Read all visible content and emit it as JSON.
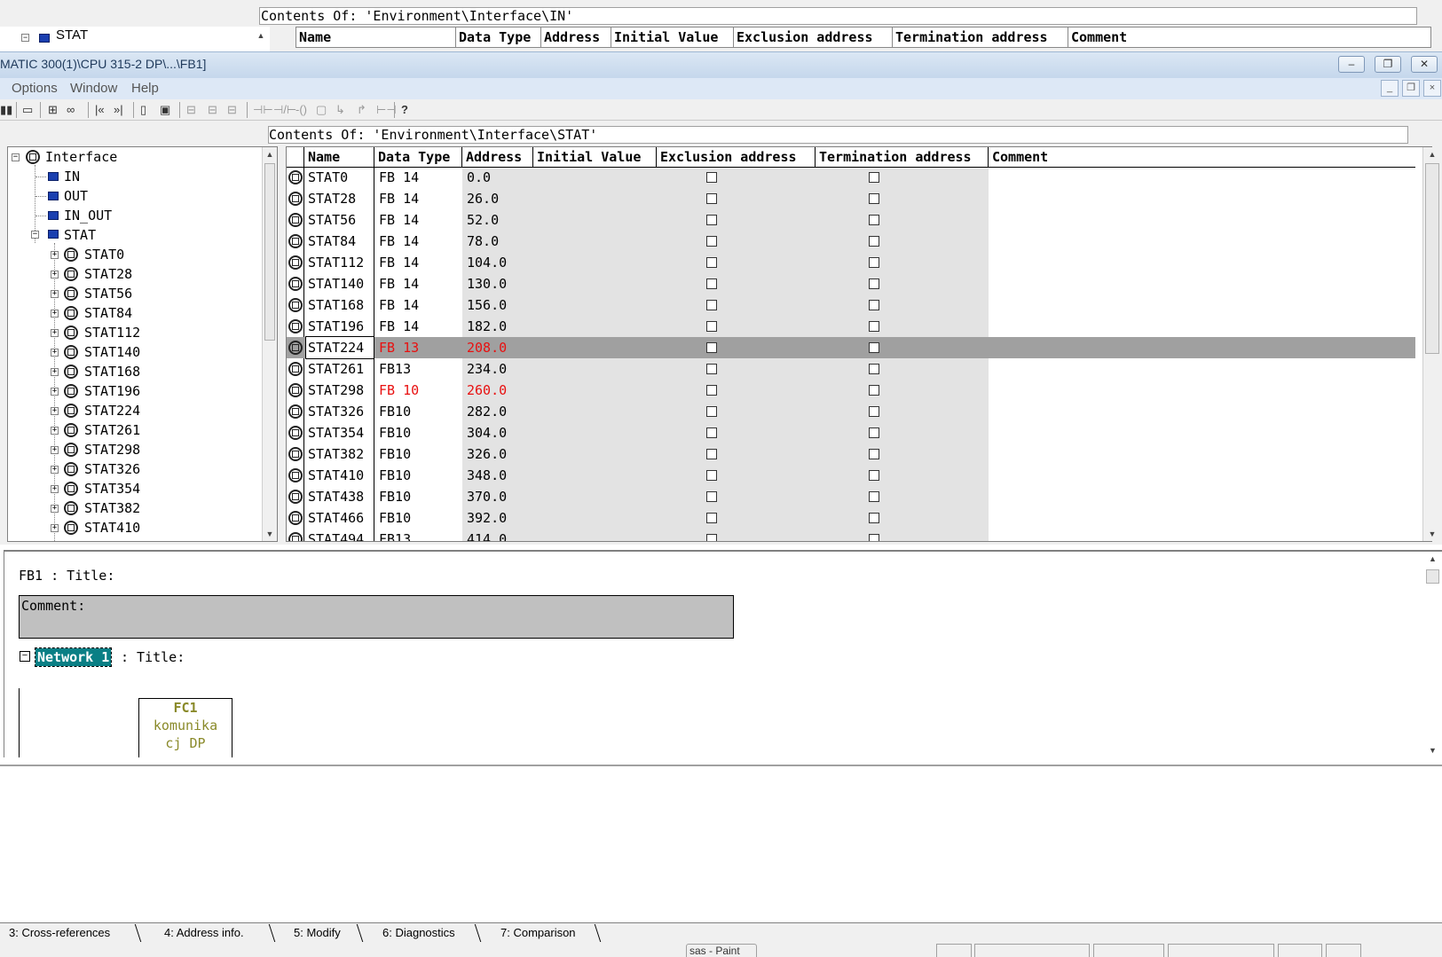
{
  "background_window": {
    "tree_item": "STAT",
    "contents_label": "Contents Of: 'Environment\\Interface\\IN'",
    "columns": [
      "Name",
      "Data Type",
      "Address",
      "Initial Value",
      "Exclusion address",
      "Termination address",
      "Comment"
    ]
  },
  "window": {
    "title": "MATIC 300(1)\\CPU 315-2 DP\\...\\FB1]",
    "controls": {
      "minimize": "–",
      "restore": "❐",
      "close": "✕"
    }
  },
  "menu": {
    "items": [
      "Options",
      "Window",
      "Help"
    ],
    "mdi_controls": [
      "_",
      "❐",
      "×"
    ]
  },
  "toolbar": {
    "icons": [
      "network-icon",
      "open-block-icon",
      "dependency-icon",
      "monitor-icon",
      "first-error-icon",
      "next-error-icon",
      "overview-icon",
      "detail-view-icon",
      "network-insert-icon",
      "branch-icon",
      "parallel-branch-icon",
      "nc-contact-icon",
      "coil-icon",
      "box-icon",
      "open-branch-icon",
      "close-branch-icon",
      "connection-icon",
      "help-icon"
    ],
    "glyphs": [
      "▮▮",
      "▭",
      "⊞",
      "∞",
      "|«",
      "»|",
      "▯",
      "▣",
      "⊟",
      "⊟",
      "⊟",
      "⊣⊢",
      "⊣/⊢",
      "-()",
      "▢",
      "↳",
      "↱",
      "⊢⊣",
      "?"
    ]
  },
  "declaration": {
    "contents_label": "Contents Of: 'Environment\\Interface\\STAT'",
    "tree": {
      "root": "Interface",
      "sections": [
        "IN",
        "OUT",
        "IN_OUT",
        "STAT"
      ],
      "stat_children": [
        "STAT0",
        "STAT28",
        "STAT56",
        "STAT84",
        "STAT112",
        "STAT140",
        "STAT168",
        "STAT196",
        "STAT224",
        "STAT261",
        "STAT298",
        "STAT326",
        "STAT354",
        "STAT382",
        "STAT410"
      ]
    },
    "table": {
      "columns": [
        "Name",
        "Data Type",
        "Address",
        "Initial Value",
        "Exclusion address",
        "Termination address",
        "Comment"
      ],
      "rows": [
        {
          "name": "STAT0",
          "type": "FB 14",
          "address": "0.0"
        },
        {
          "name": "STAT28",
          "type": "FB 14",
          "address": "26.0"
        },
        {
          "name": "STAT56",
          "type": "FB 14",
          "address": "52.0"
        },
        {
          "name": "STAT84",
          "type": "FB 14",
          "address": "78.0"
        },
        {
          "name": "STAT112",
          "type": "FB 14",
          "address": "104.0"
        },
        {
          "name": "STAT140",
          "type": "FB 14",
          "address": "130.0"
        },
        {
          "name": "STAT168",
          "type": "FB 14",
          "address": "156.0"
        },
        {
          "name": "STAT196",
          "type": "FB 14",
          "address": "182.0"
        },
        {
          "name": "STAT224",
          "type": "FB 13",
          "address": "208.0",
          "selected": true,
          "red": true
        },
        {
          "name": "STAT261",
          "type": "FB13",
          "address": "234.0"
        },
        {
          "name": "STAT298",
          "type": "FB 10",
          "address": "260.0",
          "red": true
        },
        {
          "name": "STAT326",
          "type": "FB10",
          "address": "282.0"
        },
        {
          "name": "STAT354",
          "type": "FB10",
          "address": "304.0"
        },
        {
          "name": "STAT382",
          "type": "FB10",
          "address": "326.0"
        },
        {
          "name": "STAT410",
          "type": "FB10",
          "address": "348.0"
        },
        {
          "name": "STAT438",
          "type": "FB10",
          "address": "370.0"
        },
        {
          "name": "STAT466",
          "type": "FB10",
          "address": "392.0"
        },
        {
          "name": "STAT494",
          "type": "FB13",
          "address": "414.0"
        }
      ],
      "error_color": "#e81010",
      "selected_color": "#a0a0a0"
    }
  },
  "code": {
    "block_title": "FB1 : Title:",
    "comment_label": "Comment:",
    "network_toggle": "−",
    "network_label": "Network 1",
    "network_title": ": Title:",
    "fc_box": {
      "name": "FC1",
      "line1": "komunika",
      "line2": "cj DP"
    },
    "network_color": "#0a7f85"
  },
  "tabs": [
    "3: Cross-references",
    "4: Address info.",
    "5: Modify",
    "6: Diagnostics",
    "7: Comparison"
  ],
  "statusbar": {
    "taskbar_item": "sas - Paint"
  }
}
